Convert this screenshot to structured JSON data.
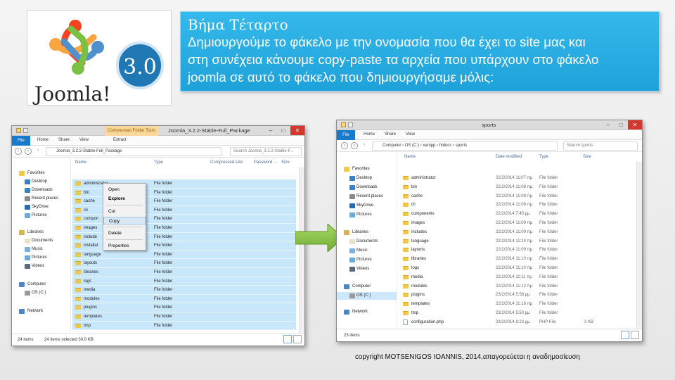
{
  "logo": {
    "version": "3.0",
    "wordmark": "Joomla!",
    "colors": [
      "#f44321",
      "#5091cd",
      "#f9a541",
      "#7ac143"
    ]
  },
  "title": {
    "heading": "Βήμα Τέταρτο",
    "lines": [
      "Δημιουργούμε το φάκελο με την ονομασία που θα έχει το site μας και",
      "στη συνέχεια κάνουμε copy-paste τα αρχεία που υπάρχουν στο φάκελο",
      "joomla σε αυτό το φάκελο που δημιουργήσαμε μόλις:"
    ]
  },
  "left_window": {
    "title": "Joomla_3.2.2-Stable-Full_Package",
    "context_tab": "Compressed Folder Tools",
    "ribbon": {
      "file": "File",
      "home": "Home",
      "share": "Share",
      "view": "View",
      "extract": "Extract"
    },
    "address": "Joomla_3.2.2-Stable-Full_Package",
    "search_placeholder": "Search Joomla_3.2.2-Stable-F...",
    "columns": {
      "name": "Name",
      "type": "Type",
      "compressed": "Compressed size",
      "password": "Password ...",
      "size": "Size"
    },
    "nav": {
      "favorites": "Favorites",
      "desktop": "Desktop",
      "downloads": "Downloads",
      "recent": "Recent places",
      "skydrive": "SkyDrive",
      "pictures": "Pictures",
      "libraries": "Libraries",
      "documents": "Documents",
      "music": "Music",
      "lib_pictures": "Pictures",
      "videos": "Videos",
      "computer": "Computer",
      "os": "OS (C:)",
      "network": "Network"
    },
    "files": [
      {
        "name": "administrator",
        "type": "File folder"
      },
      {
        "name": "bin",
        "type": "File folder"
      },
      {
        "name": "cache",
        "type": "File folder"
      },
      {
        "name": "cli",
        "type": "File folder"
      },
      {
        "name": "compon",
        "type": "File folder"
      },
      {
        "name": "images",
        "type": "File folder"
      },
      {
        "name": "include",
        "type": "File folder"
      },
      {
        "name": "installat",
        "type": "File folder"
      },
      {
        "name": "language",
        "type": "File folder"
      },
      {
        "name": "layouts",
        "type": "File folder"
      },
      {
        "name": "libraries",
        "type": "File folder"
      },
      {
        "name": "logs",
        "type": "File folder"
      },
      {
        "name": "media",
        "type": "File folder"
      },
      {
        "name": "modules",
        "type": "File folder"
      },
      {
        "name": "plugins",
        "type": "File folder"
      },
      {
        "name": "templates",
        "type": "File folder"
      },
      {
        "name": "tmp",
        "type": "File folder"
      }
    ],
    "context_menu": {
      "open": "Open",
      "explore": "Explore",
      "cut": "Cut",
      "copy": "Copy",
      "delete": "Delete",
      "properties": "Properties"
    },
    "status": {
      "count": "24 items",
      "selected": "24 items selected  30,0 KB"
    }
  },
  "right_window": {
    "title": "sports",
    "ribbon": {
      "file": "File",
      "home": "Home",
      "share": "Share",
      "view": "View"
    },
    "breadcrumb": [
      "Computer",
      "OS (C:)",
      "xampp",
      "htdocs",
      "sports"
    ],
    "search_placeholder": "Search sports",
    "columns": {
      "name": "Name",
      "date": "Date modified",
      "type": "Type",
      "size": "Size"
    },
    "nav": {
      "favorites": "Favorites",
      "desktop": "Desktop",
      "downloads": "Downloads",
      "recent": "Recent places",
      "skydrive": "SkyDrive",
      "pictures": "Pictures",
      "libraries": "Libraries",
      "documents": "Documents",
      "music": "Music",
      "lib_pictures": "Pictures",
      "videos": "Videos",
      "computer": "Computer",
      "os": "OS (C:)",
      "network": "Network"
    },
    "files": [
      {
        "name": "administrator",
        "date": "22/2/2014 11:07 πμ",
        "type": "File folder",
        "size": ""
      },
      {
        "name": "bin",
        "date": "22/2/2014 11:08 πμ",
        "type": "File folder",
        "size": ""
      },
      {
        "name": "cache",
        "date": "22/2/2014 11:08 πμ",
        "type": "File folder",
        "size": ""
      },
      {
        "name": "cli",
        "date": "22/2/2014 11:08 πμ",
        "type": "File folder",
        "size": ""
      },
      {
        "name": "components",
        "date": "22/2/2014 7:45 μμ",
        "type": "File folder",
        "size": ""
      },
      {
        "name": "images",
        "date": "22/2/2014 11:09 πμ",
        "type": "File folder",
        "size": ""
      },
      {
        "name": "includes",
        "date": "22/2/2014 11:09 πμ",
        "type": "File folder",
        "size": ""
      },
      {
        "name": "language",
        "date": "22/2/2014 11:24 πμ",
        "type": "File folder",
        "size": ""
      },
      {
        "name": "layouts",
        "date": "22/2/2014 11:09 πμ",
        "type": "File folder",
        "size": ""
      },
      {
        "name": "libraries",
        "date": "22/2/2014 11:10 πμ",
        "type": "File folder",
        "size": ""
      },
      {
        "name": "logs",
        "date": "22/2/2014 11:10 πμ",
        "type": "File folder",
        "size": ""
      },
      {
        "name": "media",
        "date": "22/2/2014 11:11 πμ",
        "type": "File folder",
        "size": ""
      },
      {
        "name": "modules",
        "date": "22/2/2014 11:12 πμ",
        "type": "File folder",
        "size": ""
      },
      {
        "name": "plugins",
        "date": "23/2/2014 5:58 μμ",
        "type": "File folder",
        "size": ""
      },
      {
        "name": "templates",
        "date": "22/2/2014 11:16 πμ",
        "type": "File folder",
        "size": ""
      },
      {
        "name": "tmp",
        "date": "23/2/2014 5:50 μμ",
        "type": "File folder",
        "size": ""
      },
      {
        "name": "configuration.php",
        "date": "23/2/2014 8:23 μμ",
        "type": "PHP File",
        "size": "3 KB"
      }
    ],
    "status": {
      "count": "23 items"
    }
  },
  "copyright": "copyright MOTSENIGOS IOANNIS, 2014,απαγορεύεται η αναδημοσίευση"
}
